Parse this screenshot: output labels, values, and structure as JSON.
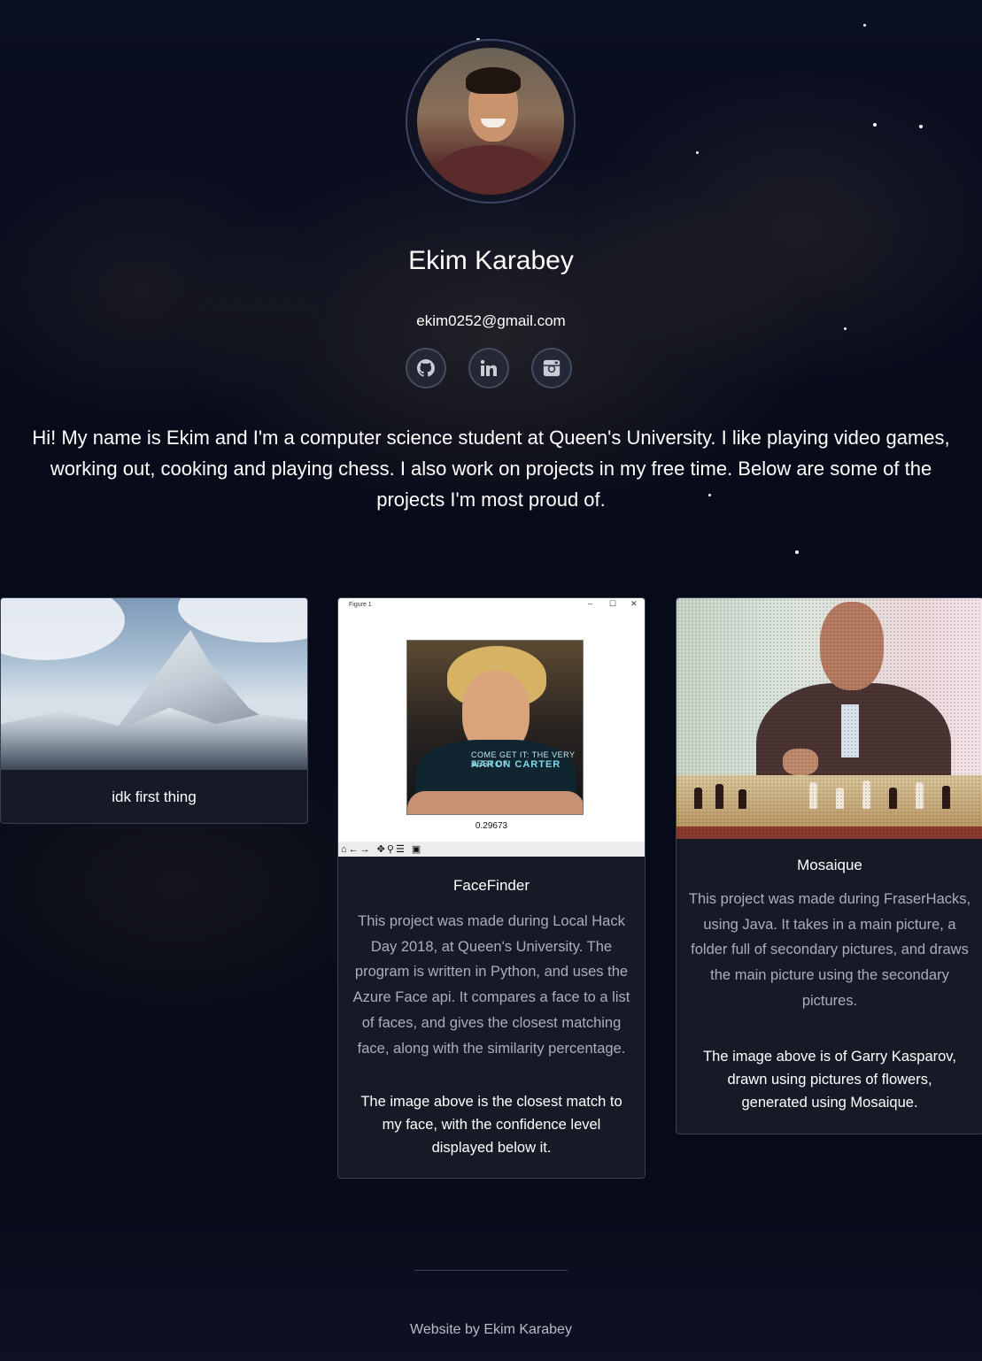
{
  "profile": {
    "name": "Ekim Karabey",
    "email": "ekim0252@gmail.com",
    "avatar_alt": "profile-photo"
  },
  "social": [
    {
      "icon": "github-icon",
      "label": "GitHub"
    },
    {
      "icon": "linkedin-icon",
      "label": "LinkedIn"
    },
    {
      "icon": "instagram-icon",
      "label": "Instagram"
    }
  ],
  "intro": {
    "line1": "Hi! My name is Ekim and I'm a computer science student at Queen's University. I like playing video games,",
    "line2": "working out, cooking and playing chess. I also work on projects in my free time. Below are some of the",
    "line3": "projects I'm most proud of."
  },
  "projects": [
    {
      "title": "idk first thing"
    },
    {
      "title": "FaceFinder",
      "window_title": "Figure 1",
      "image_caption_band": "COME GET IT: THE VERY BEST OF",
      "image_caption_name": "AARON CARTER",
      "confidence_value": "0.29673",
      "description": [
        "This project was made during Local Hack",
        "Day 2018, at Queen's University. The",
        "program is written in Python, and uses the",
        "Azure Face api. It compares a face to a list",
        "of faces, and gives the closest matching",
        "face, along with the similarity percentage."
      ],
      "note": [
        "The image above is the closest match to",
        "my face, with the confidence level",
        "displayed below it."
      ]
    },
    {
      "title": "Mosaique",
      "description": [
        "This project was made during FraserHacks,",
        "using Java. It takes in a main picture, a",
        "folder full of secondary pictures, and draws",
        "the main picture using the secondary",
        "pictures."
      ],
      "note": [
        "The image above is of Garry Kasparov,",
        "drawn using pictures of flowers,",
        "generated using Mosaique."
      ]
    }
  ],
  "footer": {
    "credit": "Website by Ekim Karabey"
  },
  "colors": {
    "background": "#070a18",
    "card": "#161a27",
    "card_border": "#3a3f50",
    "muted_text": "#a9aeba"
  }
}
